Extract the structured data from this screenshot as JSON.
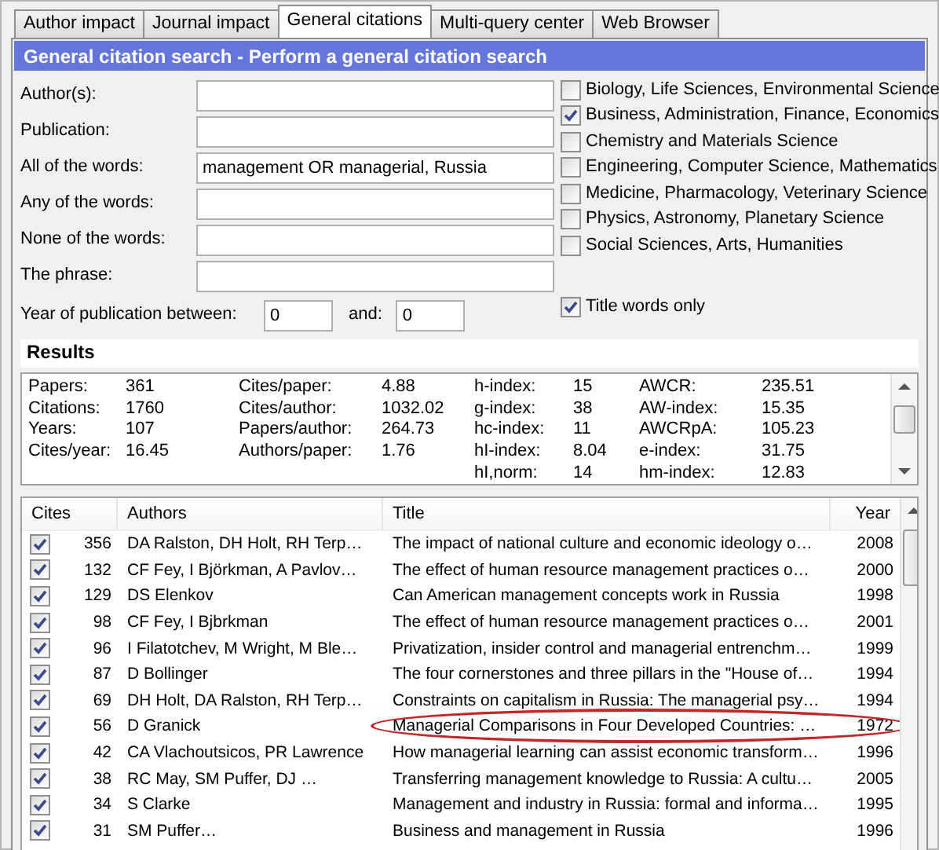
{
  "tabs": [
    {
      "label": "Author impact",
      "selected": false
    },
    {
      "label": "Journal impact",
      "selected": false
    },
    {
      "label": "General citations",
      "selected": true
    },
    {
      "label": "Multi-query center",
      "selected": false
    },
    {
      "label": "Web Browser",
      "selected": false
    }
  ],
  "header": "General citation search - Perform a general citation search",
  "fields": [
    {
      "label": "Author(s):"
    },
    {
      "label": "Publication:"
    },
    {
      "label": "All of the words:",
      "value": "management OR managerial, Russia"
    },
    {
      "label": "Any of the words:"
    },
    {
      "label": "None of the words:"
    },
    {
      "label": "The phrase:"
    }
  ],
  "subjects": [
    {
      "label": "Biology, Life Sciences, Environmental Science",
      "checked": false
    },
    {
      "label": "Business, Administration, Finance, Economics",
      "checked": true
    },
    {
      "label": "Chemistry and Materials Science",
      "checked": false
    },
    {
      "label": "Engineering, Computer Science, Mathematics",
      "checked": false
    },
    {
      "label": "Medicine, Pharmacology, Veterinary Science",
      "checked": false
    },
    {
      "label": "Physics, Astronomy, Planetary Science",
      "checked": false
    },
    {
      "label": "Social Sciences, Arts, Humanities",
      "checked": false
    }
  ],
  "year_range": {
    "label": "Year of publication between:",
    "from": "0",
    "and_label": "and:",
    "to": "0"
  },
  "title_words_only": {
    "label": "Title words only",
    "checked": true
  },
  "results_label": "Results",
  "stats": [
    [
      {
        "label": "Papers:",
        "value": "361"
      },
      {
        "label": "Citations:",
        "value": "1760"
      },
      {
        "label": "Years:",
        "value": "107"
      },
      {
        "label": "Cites/year:",
        "value": "16.45"
      }
    ],
    [
      {
        "label": "Cites/paper:",
        "value": "4.88"
      },
      {
        "label": "Cites/author:",
        "value": "1032.02"
      },
      {
        "label": "Papers/author:",
        "value": "264.73"
      },
      {
        "label": "Authors/paper:",
        "value": "1.76"
      }
    ],
    [
      {
        "label": "h-index:",
        "value": "15"
      },
      {
        "label": "g-index:",
        "value": "38"
      },
      {
        "label": "hc-index:",
        "value": "11"
      },
      {
        "label": "hI-index:",
        "value": "8.04"
      },
      {
        "label": "hI,norm:",
        "value": "14"
      }
    ],
    [
      {
        "label": "AWCR:",
        "value": "235.51"
      },
      {
        "label": "AW-index:",
        "value": "15.35"
      },
      {
        "label": "AWCRpA:",
        "value": "105.23"
      },
      {
        "label": "e-index:",
        "value": "31.75"
      },
      {
        "label": "hm-index:",
        "value": "12.83"
      }
    ]
  ],
  "table": {
    "columns": [
      "Cites",
      "Authors",
      "Title",
      "Year"
    ],
    "rows": [
      {
        "checked": true,
        "cites": "356",
        "authors": "DA Ralston, DH Holt, RH Terp…",
        "title": "The impact of national culture and economic ideology o…",
        "year": "2008",
        "circled": false
      },
      {
        "checked": true,
        "cites": "132",
        "authors": "CF Fey, I Björkman, A Pavlov…",
        "title": "The effect of human resource management practices o…",
        "year": "2000",
        "circled": false
      },
      {
        "checked": true,
        "cites": "129",
        "authors": "DS Elenkov",
        "title": "Can American management concepts work in Russia",
        "year": "1998",
        "circled": false
      },
      {
        "checked": true,
        "cites": "98",
        "authors": "CF Fey, I Bjbrkman",
        "title": "The effect of human resource management practices o…",
        "year": "2001",
        "circled": false
      },
      {
        "checked": true,
        "cites": "96",
        "authors": "I Filatotchev, M Wright, M Ble…",
        "title": "Privatization, insider control and managerial entrenchm…",
        "year": "1999",
        "circled": false
      },
      {
        "checked": true,
        "cites": "87",
        "authors": "D Bollinger",
        "title": "The four cornerstones and three pillars in the \"House of…",
        "year": "1994",
        "circled": false
      },
      {
        "checked": true,
        "cites": "69",
        "authors": "DH Holt, DA Ralston, RH Terp…",
        "title": "Constraints on capitalism in Russia: The managerial psy…",
        "year": "1994",
        "circled": false
      },
      {
        "checked": true,
        "cites": "56",
        "authors": "D Granick",
        "title": "Managerial Comparisons in Four Developed Countries: …",
        "year": "1972",
        "circled": true
      },
      {
        "checked": true,
        "cites": "42",
        "authors": "CA Vlachoutsicos, PR Lawrence",
        "title": "How managerial learning can assist economic transform…",
        "year": "1996",
        "circled": false
      },
      {
        "checked": true,
        "cites": "38",
        "authors": "RC May, SM Puffer, DJ …",
        "title": "Transferring management knowledge to Russia: A cultu…",
        "year": "2005",
        "circled": false
      },
      {
        "checked": true,
        "cites": "34",
        "authors": "S Clarke",
        "title": "Management and industry in Russia: formal and informa…",
        "year": "1995",
        "circled": false
      },
      {
        "checked": true,
        "cites": "31",
        "authors": "SM Puffer…",
        "title": "Business and management in Russia",
        "year": "1996",
        "circled": false
      }
    ]
  }
}
